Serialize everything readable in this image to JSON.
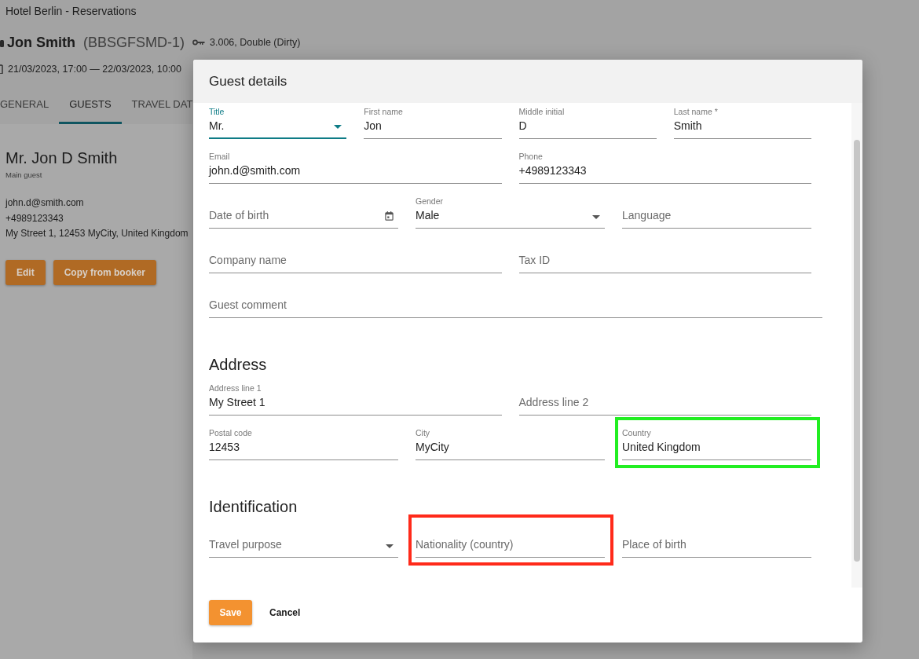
{
  "app_title": "Hotel Berlin - Reservations",
  "reservation": {
    "guest_name": "Jon Smith",
    "booking_id": "(BBSGFSMD-1)",
    "unit": "3.006, Double (Dirty)",
    "dates": "21/03/2023, 17:00 — 22/03/2023, 10:00"
  },
  "tabs": [
    {
      "label": "GENERAL",
      "selected": false
    },
    {
      "label": "GUESTS",
      "selected": true
    },
    {
      "label": "TRAVEL DAT",
      "selected": false
    }
  ],
  "guest_card": {
    "name": "Mr. Jon D Smith",
    "role": "Main guest",
    "email": "john.d@smith.com",
    "phone": "+4989123343",
    "address": "My Street 1, 12453 MyCity, United Kingdom",
    "buttons": [
      "Edit",
      "Copy from booker"
    ]
  },
  "dialog": {
    "title": "Guest details",
    "sections": [
      {
        "rows": [
          {
            "fields": [
              {
                "label": "Title",
                "value": "Mr.",
                "kind": "select",
                "focused": true
              },
              {
                "label": "First name",
                "value": "Jon",
                "kind": "text",
                "focused": false
              },
              {
                "label": "Middle initial",
                "value": "D",
                "kind": "text",
                "focused": false
              },
              {
                "label": "Last name *",
                "value": "Smith",
                "kind": "text",
                "focused": false
              }
            ]
          },
          {
            "fields": [
              {
                "label": "Email",
                "value": "john.d@smith.com",
                "kind": "text",
                "focused": false
              },
              {
                "label": "Phone",
                "value": "+4989123343",
                "kind": "text",
                "focused": false
              }
            ]
          },
          {
            "fields": [
              {
                "label": "Date of birth",
                "kind": "date",
                "focused": false
              },
              {
                "label": "Gender",
                "value": "Male",
                "kind": "select",
                "focused": false
              },
              {
                "label": "Language",
                "kind": "text",
                "focused": false
              }
            ]
          },
          {
            "fields": [
              {
                "label": "Company name",
                "kind": "text",
                "focused": false
              },
              {
                "label": "Tax ID",
                "kind": "text",
                "focused": false
              }
            ]
          },
          {
            "fields": [
              {
                "label": "Guest comment",
                "kind": "text",
                "focused": false
              }
            ]
          }
        ]
      },
      {
        "heading": "Address",
        "rows": [
          {
            "fields": [
              {
                "label": "Address line 1",
                "value": "My Street 1",
                "kind": "text",
                "focused": false
              },
              {
                "label": "Address line 2",
                "kind": "text",
                "focused": false
              }
            ]
          },
          {
            "fields": [
              {
                "label": "Postal code",
                "value": "12453",
                "kind": "text",
                "focused": false
              },
              {
                "label": "City",
                "value": "MyCity",
                "kind": "text",
                "focused": false
              },
              {
                "label": "Country",
                "value": "United Kingdom",
                "kind": "text",
                "focused": false,
                "color": "#22ee22"
              }
            ]
          }
        ]
      },
      {
        "heading": "Identification",
        "rows": [
          {
            "fields": [
              {
                "label": "Travel purpose",
                "kind": "select",
                "focused": false
              },
              {
                "label": "Nationality (country)",
                "kind": "text",
                "focused": false,
                "color": "#ff2a1a"
              },
              {
                "label": "Place of birth",
                "kind": "text",
                "focused": false
              }
            ]
          }
        ]
      }
    ],
    "actions": [
      {
        "label": "Save",
        "kind": "primary"
      },
      {
        "label": "Cancel",
        "kind": "text"
      }
    ]
  }
}
